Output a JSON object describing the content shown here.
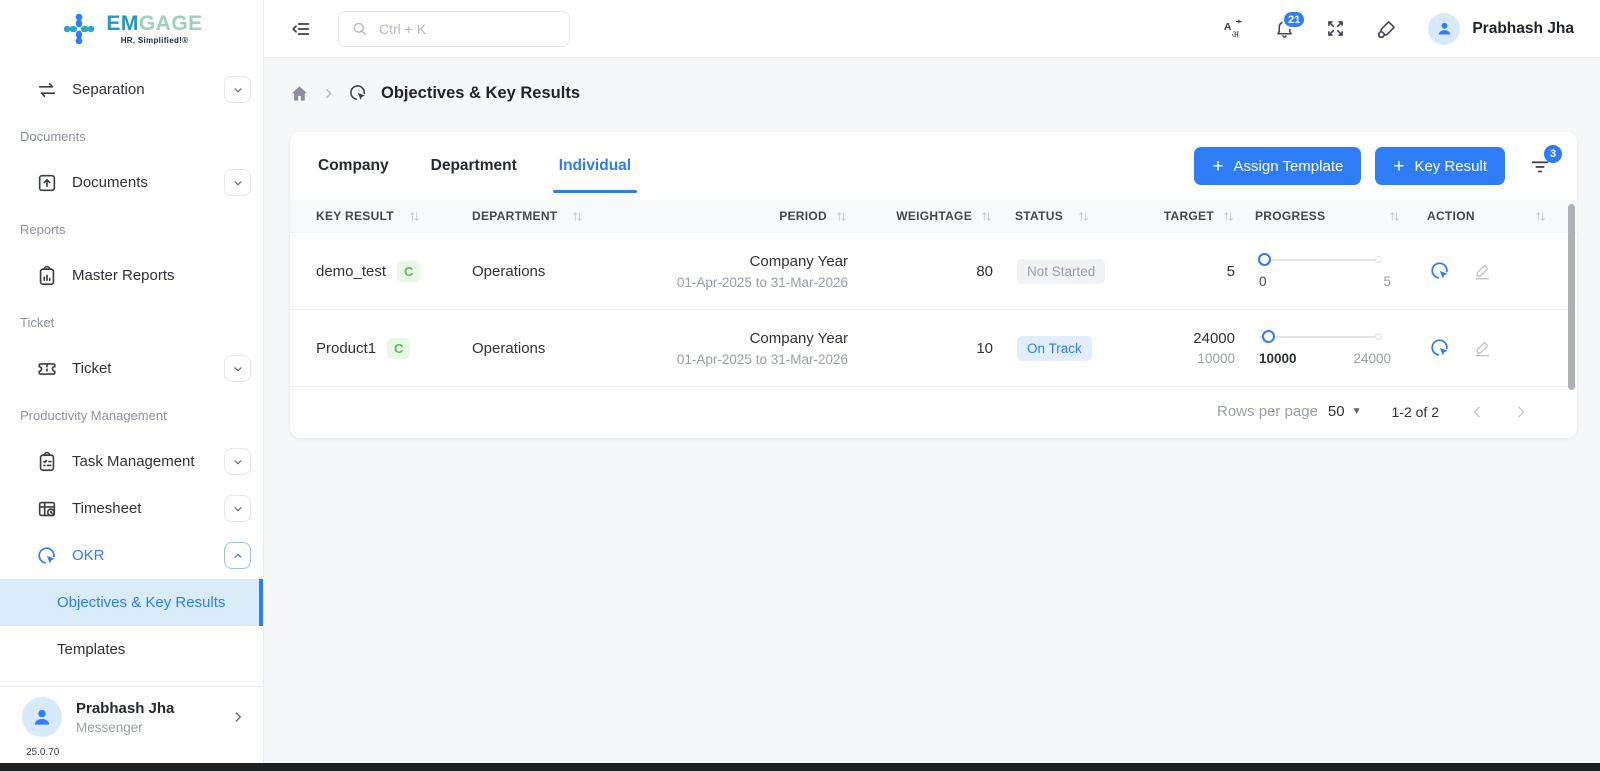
{
  "colors": {
    "accent": "#2e7cf6",
    "green_badge": "#5cb85c",
    "active_item_bg": "#d8ecfa"
  },
  "logo": {
    "name_primary": "EM",
    "name_secondary": "GAGE",
    "tagline": "HR, Simplified!®"
  },
  "topbar": {
    "search_placeholder": "Ctrl + K",
    "notification_count": "21",
    "user_name": "Prabhash Jha"
  },
  "sidebar": {
    "items": [
      {
        "label": "Separation"
      },
      {
        "label": "Documents"
      },
      {
        "label": "Master Reports"
      },
      {
        "label": "Ticket"
      },
      {
        "label": "Task Management"
      },
      {
        "label": "Timesheet"
      },
      {
        "label": "OKR"
      },
      {
        "label": "Objectives & Key Results"
      },
      {
        "label": "Templates"
      }
    ],
    "sections": {
      "documents": "Documents",
      "reports": "Reports",
      "ticket": "Ticket",
      "productivity": "Productivity Management"
    },
    "user": {
      "name": "Prabhash Jha",
      "subtitle": "Messenger"
    },
    "version": "25.0.70"
  },
  "breadcrumb": {
    "page_title": "Objectives & Key Results"
  },
  "toolbar": {
    "tabs": [
      {
        "label": "Company"
      },
      {
        "label": "Department"
      },
      {
        "label": "Individual"
      }
    ],
    "plus": "+",
    "assign_template_label": "Assign Template",
    "key_result_label": "Key Result",
    "filter_badge": "3"
  },
  "table": {
    "headers": [
      "KEY RESULT",
      "DEPARTMENT",
      "PERIOD",
      "WEIGHTAGE",
      "STATUS",
      "TARGET",
      "PROGRESS",
      "ACTION"
    ],
    "rows": [
      {
        "key_result": "demo_test",
        "badge": "C",
        "department": "Operations",
        "period_title": "Company Year",
        "period_range": "01-Apr-2025 to 31-Mar-2026",
        "weightage": "80",
        "status": "Not Started",
        "target": "5",
        "target_secondary": "",
        "progress_min": "0",
        "progress_max": "5"
      },
      {
        "key_result": "Product1",
        "badge": "C",
        "department": "Operations",
        "period_title": "Company Year",
        "period_range": "01-Apr-2025 to 31-Mar-2026",
        "weightage": "10",
        "status": "On Track",
        "target": "24000",
        "target_secondary": "10000",
        "progress_min": "10000",
        "progress_max": "24000"
      }
    ],
    "footer": {
      "rows_per_page_label": "Rows per page",
      "rows_per_page_value": "50",
      "range_label": "1-2 of 2"
    }
  }
}
